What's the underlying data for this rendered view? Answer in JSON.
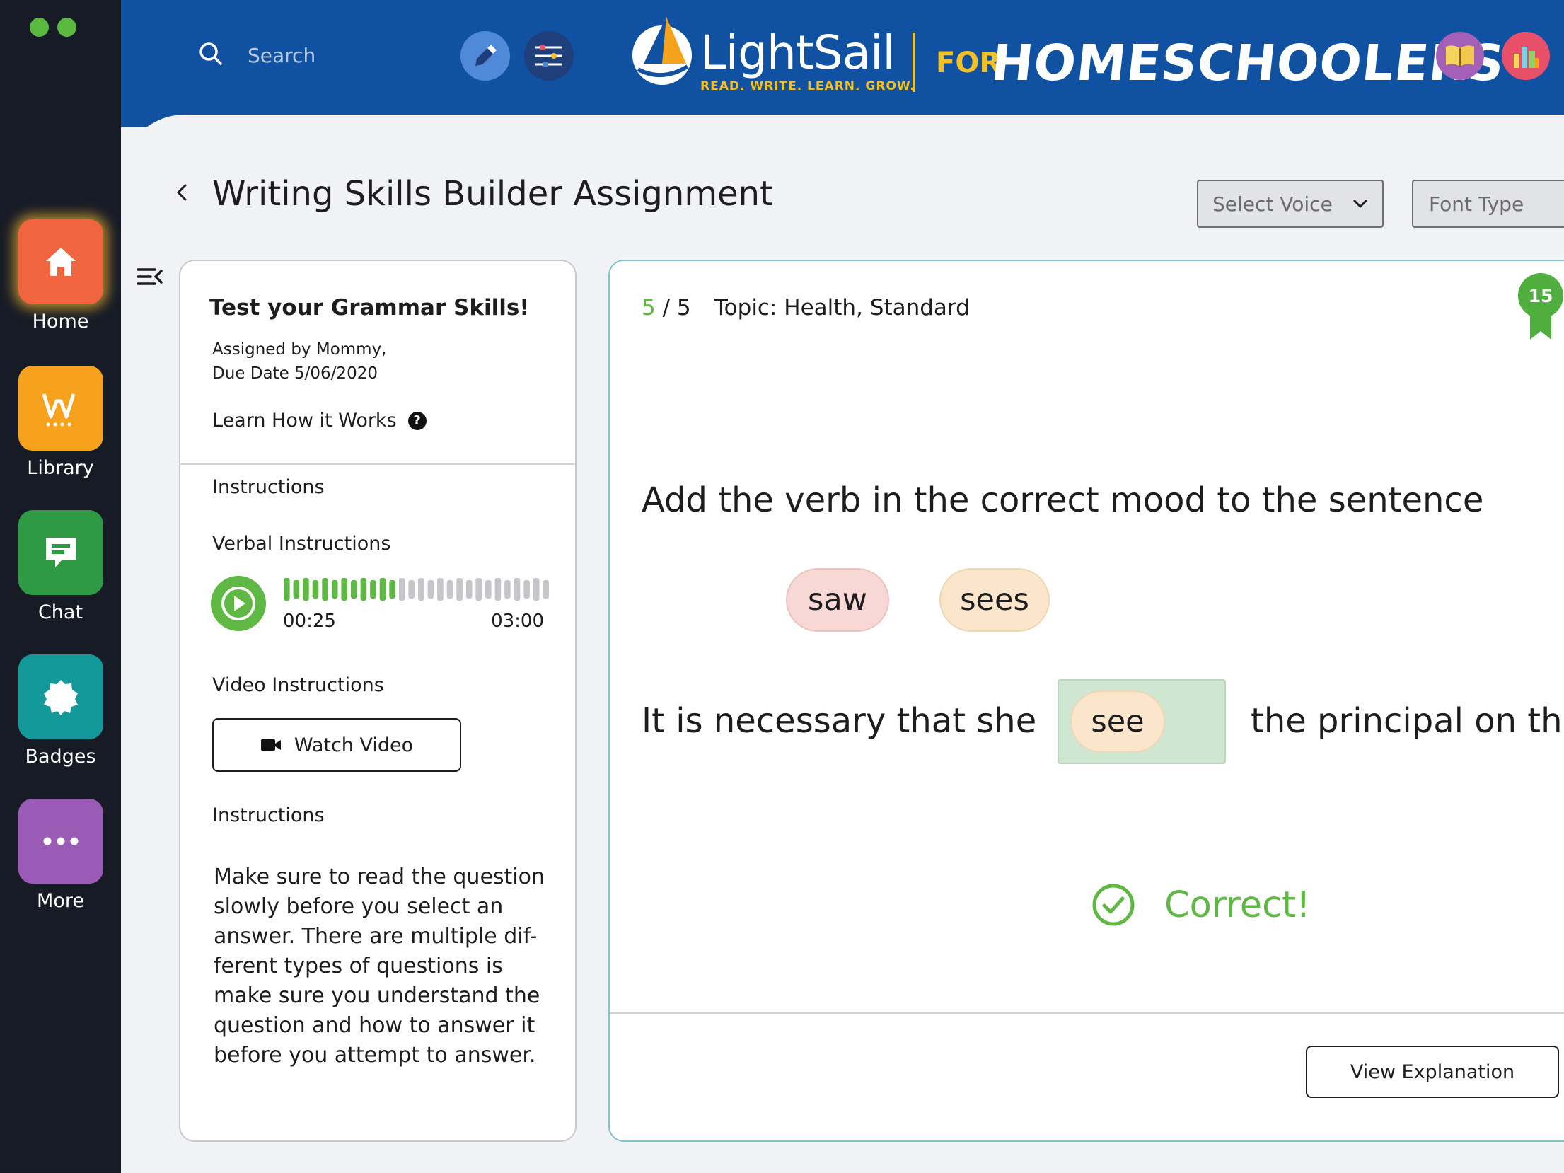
{
  "sidebar": {
    "items": [
      {
        "label": "Home",
        "icon": "home-icon"
      },
      {
        "label": "Library",
        "icon": "library-w-icon"
      },
      {
        "label": "Chat",
        "icon": "chat-icon"
      },
      {
        "label": "Badges",
        "icon": "badge-icon"
      },
      {
        "label": "More",
        "icon": "more-dots-icon"
      }
    ]
  },
  "header": {
    "search_placeholder": "Search",
    "brand_name": "LightSail",
    "brand_tagline": "READ. WRITE. LEARN. GROW.",
    "brand_for": "FOR",
    "brand_audience": "HOMESCHOOLERS"
  },
  "page": {
    "title": "Writing Skills Builder Assignment",
    "select_voice": "Select Voice",
    "font_type": "Font Type"
  },
  "assignment": {
    "title": "Test your Grammar Skills!",
    "assigned_by": "Assigned by Mommy,",
    "due_date": "Due Date 5/06/2020",
    "learn_link": "Learn How it Works",
    "instructions_heading": "Instructions",
    "verbal_heading": "Verbal Instructions",
    "audio": {
      "elapsed": "00:25",
      "duration": "03:00",
      "progress_fraction": 0.42
    },
    "video_heading": "Video Instructions",
    "watch_video_label": "Watch Video",
    "instructions_heading_2": "Instructions",
    "instructions_text": "Make sure to read the question slowly before you select an answer. There are multiple dif-ferent types of questions is make sure you understand the question and how to answer it before you attempt to answer."
  },
  "question": {
    "current": "5",
    "separator": "/",
    "total": "5",
    "topic": "Topic: Health, Standard",
    "prompt": "Add the verb in the correct mood to the sentence",
    "choices": [
      "saw",
      "sees"
    ],
    "sentence_before": "It is necessary that she",
    "answer": "see",
    "sentence_after": "the principal on th",
    "feedback": "Correct!",
    "view_explanation_label": "View Explanation",
    "score": "15"
  },
  "colors": {
    "header_bg": "#1151a1",
    "rail_bg": "#161b26",
    "accent_green": "#5fb843",
    "brand_yellow": "#f5c022"
  }
}
